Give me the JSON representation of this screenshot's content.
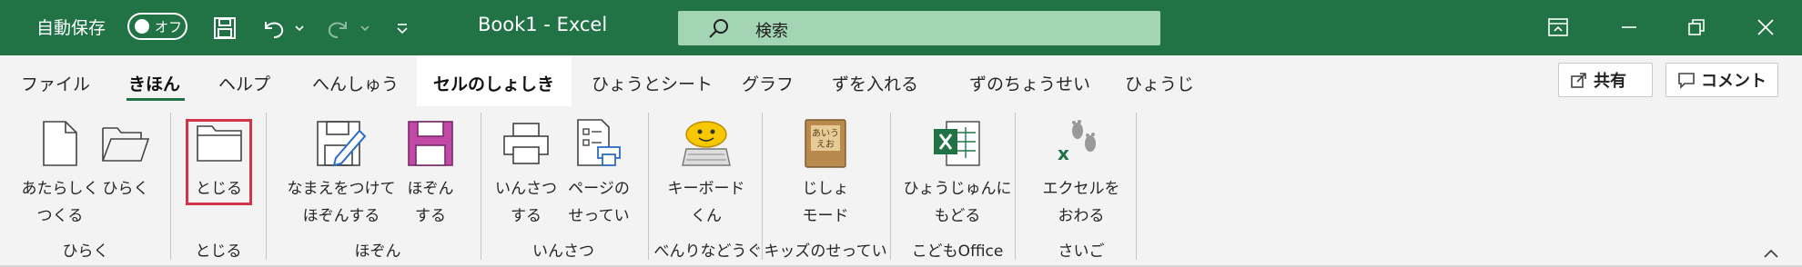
{
  "titlebar": {
    "autosave_label": "自動保存",
    "autosave_state": "オフ",
    "document_title": "Book1  -  Excel",
    "search_placeholder": "検索",
    "accent_color": "#217346"
  },
  "tabs": [
    {
      "label": "ファイル"
    },
    {
      "label": "きほん",
      "selected": true
    },
    {
      "label": "ヘルプ"
    },
    {
      "label": "へんしゅう"
    },
    {
      "label": "セルのしょしき",
      "active": true
    },
    {
      "label": "ひょうとシート"
    },
    {
      "label": "グラフ"
    },
    {
      "label": "ずを入れる"
    },
    {
      "label": "ずのちょうせい"
    },
    {
      "label": "ひょうじ"
    }
  ],
  "right_buttons": {
    "share_label": "共有",
    "comment_label": "コメント"
  },
  "ribbon": {
    "commands": {
      "new": {
        "line1": "あたらしく",
        "line2": "つくる"
      },
      "open": {
        "line1": "ひらく"
      },
      "close": {
        "line1": "とじる"
      },
      "save_as": {
        "line1": "なまえをつけて",
        "line2": "ほぞんする"
      },
      "save": {
        "line1": "ほぞん",
        "line2": "する"
      },
      "print": {
        "line1": "いんさつ",
        "line2": "する"
      },
      "page_setup": {
        "line1": "ページの",
        "line2": "せってい"
      },
      "keyboard": {
        "line1": "キーボード",
        "line2": "くん"
      },
      "jisho": {
        "line1": "じしょ",
        "line2": "モード"
      },
      "table": {
        "line1": "ひょうじゅんに",
        "line2": "もどる"
      },
      "exit": {
        "line1": "エクセルを",
        "line2": "おわる"
      }
    },
    "groups": {
      "open_group": "ひらく",
      "close_group": "とじる",
      "save_group": "ほぞん",
      "print_group": "いんさつ",
      "tools_group": "べんりなどうぐ",
      "kids_group": "キッズのせってい",
      "kodomo_group": "こどもOffice",
      "last_group": "さいご"
    },
    "jisho_icon_text": "あいう えお"
  }
}
